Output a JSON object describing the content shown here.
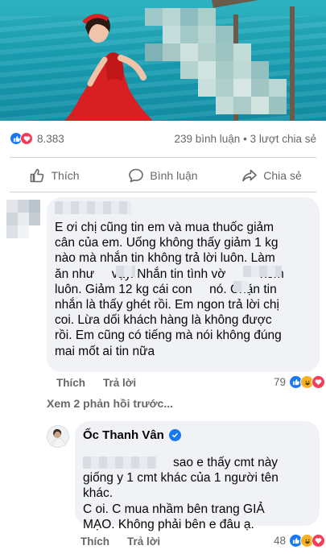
{
  "post": {
    "reactions": {
      "count": "8.383",
      "icons": [
        "like-icon",
        "love-icon"
      ]
    },
    "comments_count": "239 bình luận",
    "separator": "•",
    "shares_count": "3 lượt chia sẻ"
  },
  "actions": {
    "like_label": "Thích",
    "comment_label": "Bình luận",
    "share_label": "Chia sẻ"
  },
  "comment": {
    "text": "E ơi chị cũng tin em và mua thuốc giảm\ncân của em. Uống không thấy giảm 1 kg\nnào mà nhắn tin không trả lời luôn. Làm\năn như     vậy. Nhắn tin tình vờ          xem\nluôn. Giảm 12 kg cái con     nó. Chặn tin\nnhắn là thấy ghét rồi. Em ngon trả lời chị\ncoi. Lừa dối khách hàng là không được\nrồi. Em cũng có tiếng mà nói không đúng\nmai mốt ai tin nữa",
    "like_label": "Thích",
    "reply_label": "Trả lời",
    "reaction_count": "79",
    "reaction_icons": [
      "like-icon",
      "love-icon",
      "haha-icon"
    ]
  },
  "previous_replies": "Xem 2 phản hồi trước...",
  "reply": {
    "author": "Ốc Thanh Vân",
    "text": "                          sao e thấy cmt này\ngiống y 1 cmt khác của 1 người tên\nkhác.\nC oi. C mua nhầm bên trang GIẢ\nMẠO. Không phải bên e đâu ạ.",
    "like_label": "Thích",
    "reply_label": "Trả lời",
    "reaction_count": "48",
    "reaction_icons": [
      "like-icon",
      "love-icon",
      "haha-icon"
    ]
  },
  "colors": {
    "facebook_blue": "#1877f2",
    "love_red": "#f33e58",
    "haha_yellow": "#f7b125",
    "bubble_bg": "#f0f2f5",
    "secondary_text": "#65676b"
  }
}
